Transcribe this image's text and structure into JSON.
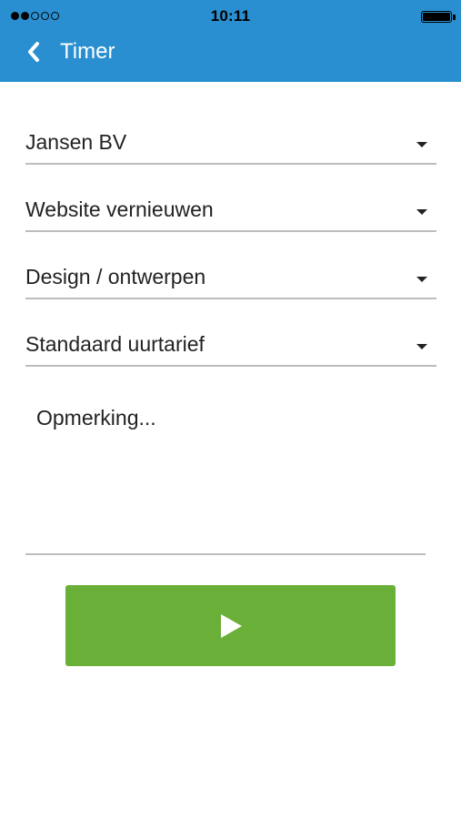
{
  "status_bar": {
    "signal_dots_filled": 2,
    "signal_dots_total": 5,
    "time": "10:11",
    "battery_level": 1.0
  },
  "nav": {
    "back_icon": "chevron-left-icon",
    "title": "Timer"
  },
  "form": {
    "client": {
      "value": "Jansen BV"
    },
    "project": {
      "value": "Website vernieuwen"
    },
    "task": {
      "value": "Design / ontwerpen"
    },
    "rate": {
      "value": "Standaard uurtarief"
    },
    "remark": {
      "placeholder": "Opmerking...",
      "value": ""
    }
  },
  "actions": {
    "start_icon": "play-icon",
    "start_color": "#6aaf37"
  },
  "colors": {
    "header": "#2a8fd0",
    "underline": "#bdbdbd",
    "text": "#222222"
  }
}
